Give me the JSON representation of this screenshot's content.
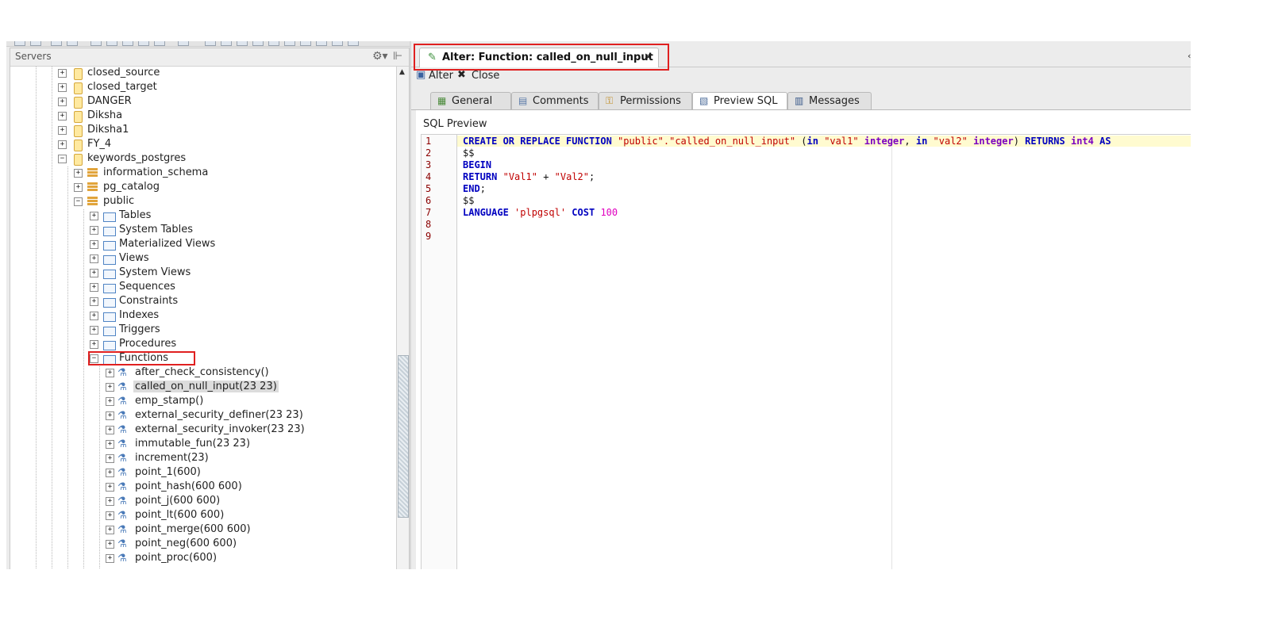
{
  "servers_panel": {
    "title": "Servers",
    "tree": [
      {
        "label": "closed_source",
        "icon": "database-icon",
        "expander": "+"
      },
      {
        "label": "closed_target",
        "icon": "database-icon",
        "expander": "+"
      },
      {
        "label": "DANGER",
        "icon": "database-icon",
        "expander": "+"
      },
      {
        "label": "Diksha",
        "icon": "database-icon",
        "expander": "+"
      },
      {
        "label": "Diksha1",
        "icon": "database-icon",
        "expander": "+"
      },
      {
        "label": "FY_4",
        "icon": "database-icon",
        "expander": "+"
      },
      {
        "label": "keywords_postgres",
        "icon": "database-icon",
        "expander": "−"
      },
      {
        "label": "information_schema",
        "icon": "schema-icon",
        "expander": "+"
      },
      {
        "label": "pg_catalog",
        "icon": "schema-icon",
        "expander": "+"
      },
      {
        "label": "public",
        "icon": "schema-icon",
        "expander": "−"
      },
      {
        "label": "Tables",
        "icon": "folder-icon",
        "expander": "+"
      },
      {
        "label": "System Tables",
        "icon": "folder-icon",
        "expander": "+"
      },
      {
        "label": "Materialized Views",
        "icon": "folder-icon",
        "expander": "+"
      },
      {
        "label": "Views",
        "icon": "folder-icon",
        "expander": "+"
      },
      {
        "label": "System Views",
        "icon": "folder-icon",
        "expander": "+"
      },
      {
        "label": "Sequences",
        "icon": "folder-icon",
        "expander": "+"
      },
      {
        "label": "Constraints",
        "icon": "folder-icon",
        "expander": "+"
      },
      {
        "label": "Indexes",
        "icon": "folder-icon",
        "expander": "+"
      },
      {
        "label": "Triggers",
        "icon": "folder-icon",
        "expander": "+"
      },
      {
        "label": "Procedures",
        "icon": "folder-icon",
        "expander": "+"
      },
      {
        "label": "Functions",
        "icon": "folder-icon",
        "expander": "−"
      },
      {
        "label": "after_check_consistency()",
        "icon": "function-icon",
        "expander": "+"
      },
      {
        "label": "called_on_null_input(23 23)",
        "icon": "function-icon",
        "expander": "+"
      },
      {
        "label": "emp_stamp()",
        "icon": "function-icon",
        "expander": "+"
      },
      {
        "label": "external_security_definer(23 23)",
        "icon": "function-icon",
        "expander": "+"
      },
      {
        "label": "external_security_invoker(23 23)",
        "icon": "function-icon",
        "expander": "+"
      },
      {
        "label": "immutable_fun(23 23)",
        "icon": "function-icon",
        "expander": "+"
      },
      {
        "label": "increment(23)",
        "icon": "function-icon",
        "expander": "+"
      },
      {
        "label": "point_1(600)",
        "icon": "function-icon",
        "expander": "+"
      },
      {
        "label": "point_hash(600 600)",
        "icon": "function-icon",
        "expander": "+"
      },
      {
        "label": "point_j(600 600)",
        "icon": "function-icon",
        "expander": "+"
      },
      {
        "label": "point_lt(600 600)",
        "icon": "function-icon",
        "expander": "+"
      },
      {
        "label": "point_merge(600 600)",
        "icon": "function-icon",
        "expander": "+"
      },
      {
        "label": "point_neg(600 600)",
        "icon": "function-icon",
        "expander": "+"
      },
      {
        "label": "point_proc(600)",
        "icon": "function-icon",
        "expander": "+"
      }
    ]
  },
  "editor": {
    "tab_title": "Alter: Function: called_on_null_input",
    "tab_close": "×",
    "actions": {
      "alter": "Alter",
      "close": "Close"
    },
    "subtabs": [
      "General",
      "Comments",
      "Permissions",
      "Preview SQL",
      "Messages"
    ],
    "active_subtab": "Preview SQL",
    "preview_label": "SQL Preview",
    "line_numbers": [
      "1",
      "2",
      "3",
      "4",
      "5",
      "6",
      "7",
      "8",
      "9"
    ],
    "code": {
      "l1": {
        "create": "CREATE OR REPLACE FUNCTION",
        "name": "\"public\".\"called_on_null_input\"",
        "open": "(",
        "in1": "in",
        "v1": "\"val1\"",
        "t1": "integer",
        "comma": ",",
        "in2": "in",
        "v2": "\"val2\"",
        "t2": "integer",
        "close": ")",
        "returns": "RETURNS",
        "rt": "int4",
        "as": "AS"
      },
      "l2": "$$",
      "l3": "BEGIN",
      "l4": {
        "kw": "RETURN",
        "a": "\"Val1\"",
        "op": "+",
        "b": "\"Val2\"",
        "end": ";"
      },
      "l5": {
        "kw": "END",
        "end": ";"
      },
      "l6": "$$",
      "l7": {
        "kw": "LANGUAGE",
        "lang": "'plpgsql'",
        "cost": "COST",
        "num": "100"
      }
    }
  },
  "colors": {
    "highlight_red": "#e02020",
    "keyword": "#0000c0",
    "string": "#c00000",
    "number": "#e000c0",
    "type": "#7b00c0"
  }
}
